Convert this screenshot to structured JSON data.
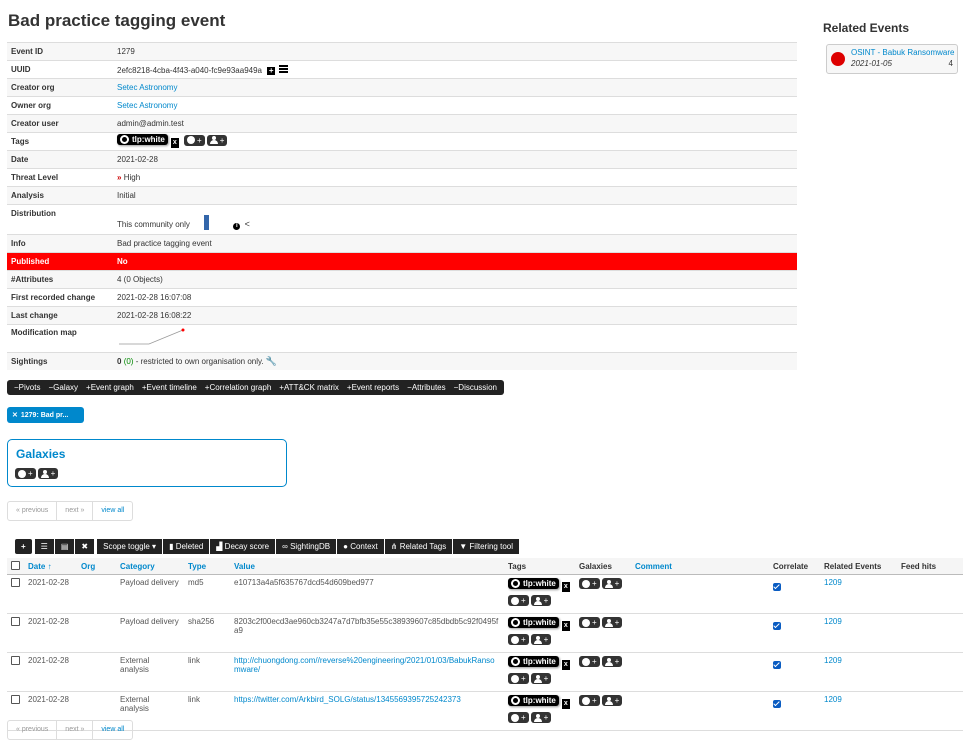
{
  "page_title": "Bad practice tagging event",
  "details": {
    "event_id_label": "Event ID",
    "event_id": "1279",
    "uuid_label": "UUID",
    "uuid": "2efc8218-4cba-4f43-a040-fc9e93aa949a",
    "creator_org_label": "Creator org",
    "creator_org": "Setec Astronomy",
    "owner_org_label": "Owner org",
    "owner_org": "Setec Astronomy",
    "creator_user_label": "Creator user",
    "creator_user": "admin@admin.test",
    "tags_label": "Tags",
    "tag": "tlp:white",
    "tag_remove": "x",
    "date_label": "Date",
    "date": "2021-02-28",
    "threat_label": "Threat Level",
    "threat": "High",
    "analysis_label": "Analysis",
    "analysis": "Initial",
    "distribution_label": "Distribution",
    "distribution": "This community only",
    "info_label": "Info",
    "info": "Bad practice tagging event",
    "published_label": "Published",
    "published": "No",
    "attributes_label": "#Attributes",
    "attributes": "4 (0 Objects)",
    "first_recorded_label": "First recorded change",
    "first_recorded": "2021-02-28 16:07:08",
    "last_change_label": "Last change",
    "last_change": "2021-02-28 16:08:22",
    "modmap_label": "Modification map",
    "sightings_label": "Sightings",
    "sightings_count": "0",
    "sightings_paren": "(0)",
    "sightings_note": "- restricted to own organisation only."
  },
  "event_nav": [
    "−Pivots",
    "−Galaxy",
    "+Event graph",
    "+Event timeline",
    "+Correlation graph",
    "+ATT&CK matrix",
    "+Event reports",
    "−Attributes",
    "−Discussion"
  ],
  "pivot_pill": "1279: Bad pr...",
  "galaxies_title": "Galaxies",
  "pager": {
    "previous": "« previous",
    "next": "next »",
    "view_all": "view all"
  },
  "toolbar": {
    "scope_toggle": "Scope toggle",
    "deleted": "Deleted",
    "decay_score": "Decay score",
    "sightingdb": "SightingDB",
    "context": "Context",
    "related_tags": "Related Tags",
    "filtering_tool": "Filtering tool"
  },
  "table": {
    "headers": [
      "Date ↑",
      "Org",
      "Category",
      "Type",
      "Value",
      "Tags",
      "Galaxies",
      "Comment",
      "Correlate",
      "Related Events",
      "Feed hits"
    ],
    "rows": [
      {
        "date": "2021-02-28",
        "category": "Payload delivery",
        "type": "md5",
        "value": "e10713a4a5f635767dcd54d609bed977",
        "tag": "tlp:white",
        "related": "1209"
      },
      {
        "date": "2021-02-28",
        "category": "Payload delivery",
        "type": "sha256",
        "value": "8203c2f00ecd3ae960cb3247a7d7bfb35e55c38939607c85dbdb5c92f0495fa9",
        "tag": "tlp:white",
        "related": "1209"
      },
      {
        "date": "2021-02-28",
        "category": "External analysis",
        "type": "link",
        "value": "http://chuongdong.com//reverse%20engineering/2021/01/03/BabukRansomware/",
        "tag": "tlp:white",
        "related": "1209"
      },
      {
        "date": "2021-02-28",
        "category": "External analysis",
        "type": "link",
        "value": "https://twitter.com/Arkbird_SOLG/status/1345569395725242373",
        "tag": "tlp:white",
        "related": "1209"
      }
    ]
  },
  "related_events": {
    "title": "Related Events",
    "items": [
      {
        "name": "OSINT - Babuk Ransomware",
        "date": "2021-01-05",
        "count": "4"
      }
    ]
  }
}
